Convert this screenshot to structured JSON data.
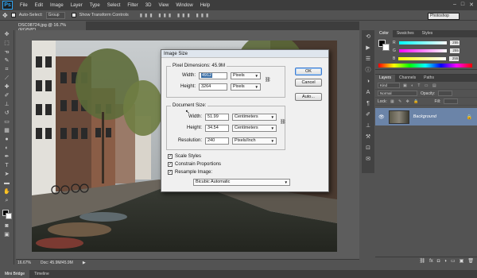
{
  "app": {
    "logo": "Ps",
    "menu": [
      "File",
      "Edit",
      "Image",
      "Layer",
      "Type",
      "Select",
      "Filter",
      "3D",
      "View",
      "Window",
      "Help"
    ]
  },
  "options": {
    "auto_select_label": "Auto-Select:",
    "auto_select_value": "Group",
    "transform_label": "Show Transform Controls",
    "workspace": "Photoshop"
  },
  "document": {
    "tab_label": "DSC08724.jpg @ 16.7% (RGB/8*)",
    "zoom": "16.67%",
    "doc_info": "Doc: 45.9M/45.9M"
  },
  "bottom_tabs": [
    "Mini Bridge",
    "Timeline"
  ],
  "color_panel": {
    "tabs": [
      "Color",
      "Swatches",
      "Styles"
    ],
    "channels": [
      {
        "label": "R",
        "value": "255"
      },
      {
        "label": "G",
        "value": "255"
      },
      {
        "label": "B",
        "value": "255"
      }
    ]
  },
  "layers_panel": {
    "tabs": [
      "Layers",
      "Channels",
      "Paths"
    ],
    "kind": "Kind",
    "blend_mode": "Normal",
    "opacity_label": "Opacity:",
    "lock_label": "Lock:",
    "fill_label": "Fill:",
    "layer_name": "Background"
  },
  "dialog": {
    "title": "Image Size",
    "pixel_dimensions": "Pixel Dimensions:  45.9M",
    "width_label": "Width:",
    "height_label": "Height:",
    "px_width": "4912",
    "px_height": "3264",
    "px_unit": "Pixels",
    "document_size": "Document Size:",
    "doc_width": "51.99",
    "doc_height": "34.54",
    "doc_unit": "Centimeters",
    "resolution_label": "Resolution:",
    "resolution": "240",
    "resolution_unit": "Pixels/Inch",
    "scale_styles": "Scale Styles",
    "constrain": "Constrain Proportions",
    "resample": "Resample Image:",
    "resample_method": "Bicubic Automatic",
    "ok": "OK",
    "cancel": "Cancel",
    "auto": "Auto...",
    "check": "✓"
  }
}
